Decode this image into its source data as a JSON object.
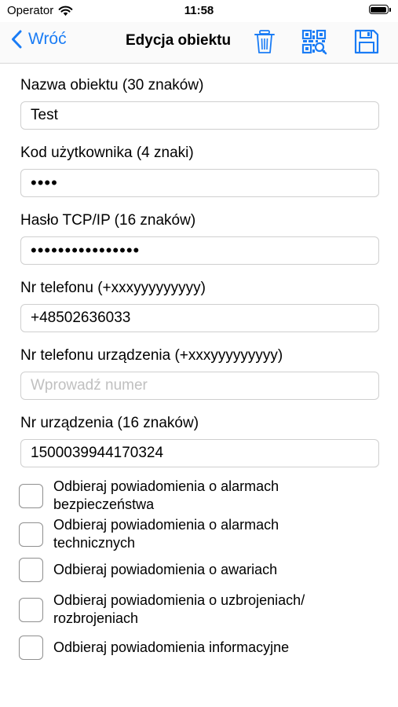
{
  "status_bar": {
    "carrier": "Operator",
    "time": "11:58"
  },
  "nav": {
    "back_label": "Wróć",
    "title": "Edycja obiektu",
    "icons": [
      "trash-icon",
      "qr-code-icon",
      "save-icon"
    ],
    "accent_color": "#1a7cf5"
  },
  "form": {
    "fields": [
      {
        "label": "Nazwa obiektu (30 znaków)",
        "value": "Test",
        "placeholder": ""
      },
      {
        "label": "Kod użytkownika (4 znaki)",
        "value": "abcd",
        "placeholder": ""
      },
      {
        "label": "Hasło TCP/IP (16 znaków)",
        "value": "abcdefghijklmnop",
        "placeholder": ""
      },
      {
        "label": "Nr telefonu (+xxxyyyyyyyyy)",
        "value": "+48502636033",
        "placeholder": ""
      },
      {
        "label": "Nr telefonu urządzenia (+xxxyyyyyyyyy)",
        "value": "",
        "placeholder": "Wprowadź numer"
      },
      {
        "label": "Nr urządzenia (16 znaków)",
        "value": "1500039944170324",
        "placeholder": ""
      }
    ]
  },
  "checkboxes": [
    {
      "label": "Odbieraj powiadomienia o alarmach bezpieczeństwa",
      "checked": false
    },
    {
      "label": "Odbieraj powiadomienia o alarmach technicznych",
      "checked": false
    },
    {
      "label": "Odbieraj powiadomienia o awariach",
      "checked": false
    },
    {
      "label": "Odbieraj powiadomienia o uzbrojeniach/ rozbrojeniach",
      "checked": false
    },
    {
      "label": "Odbieraj powiadomienia informacyjne",
      "checked": false
    }
  ]
}
